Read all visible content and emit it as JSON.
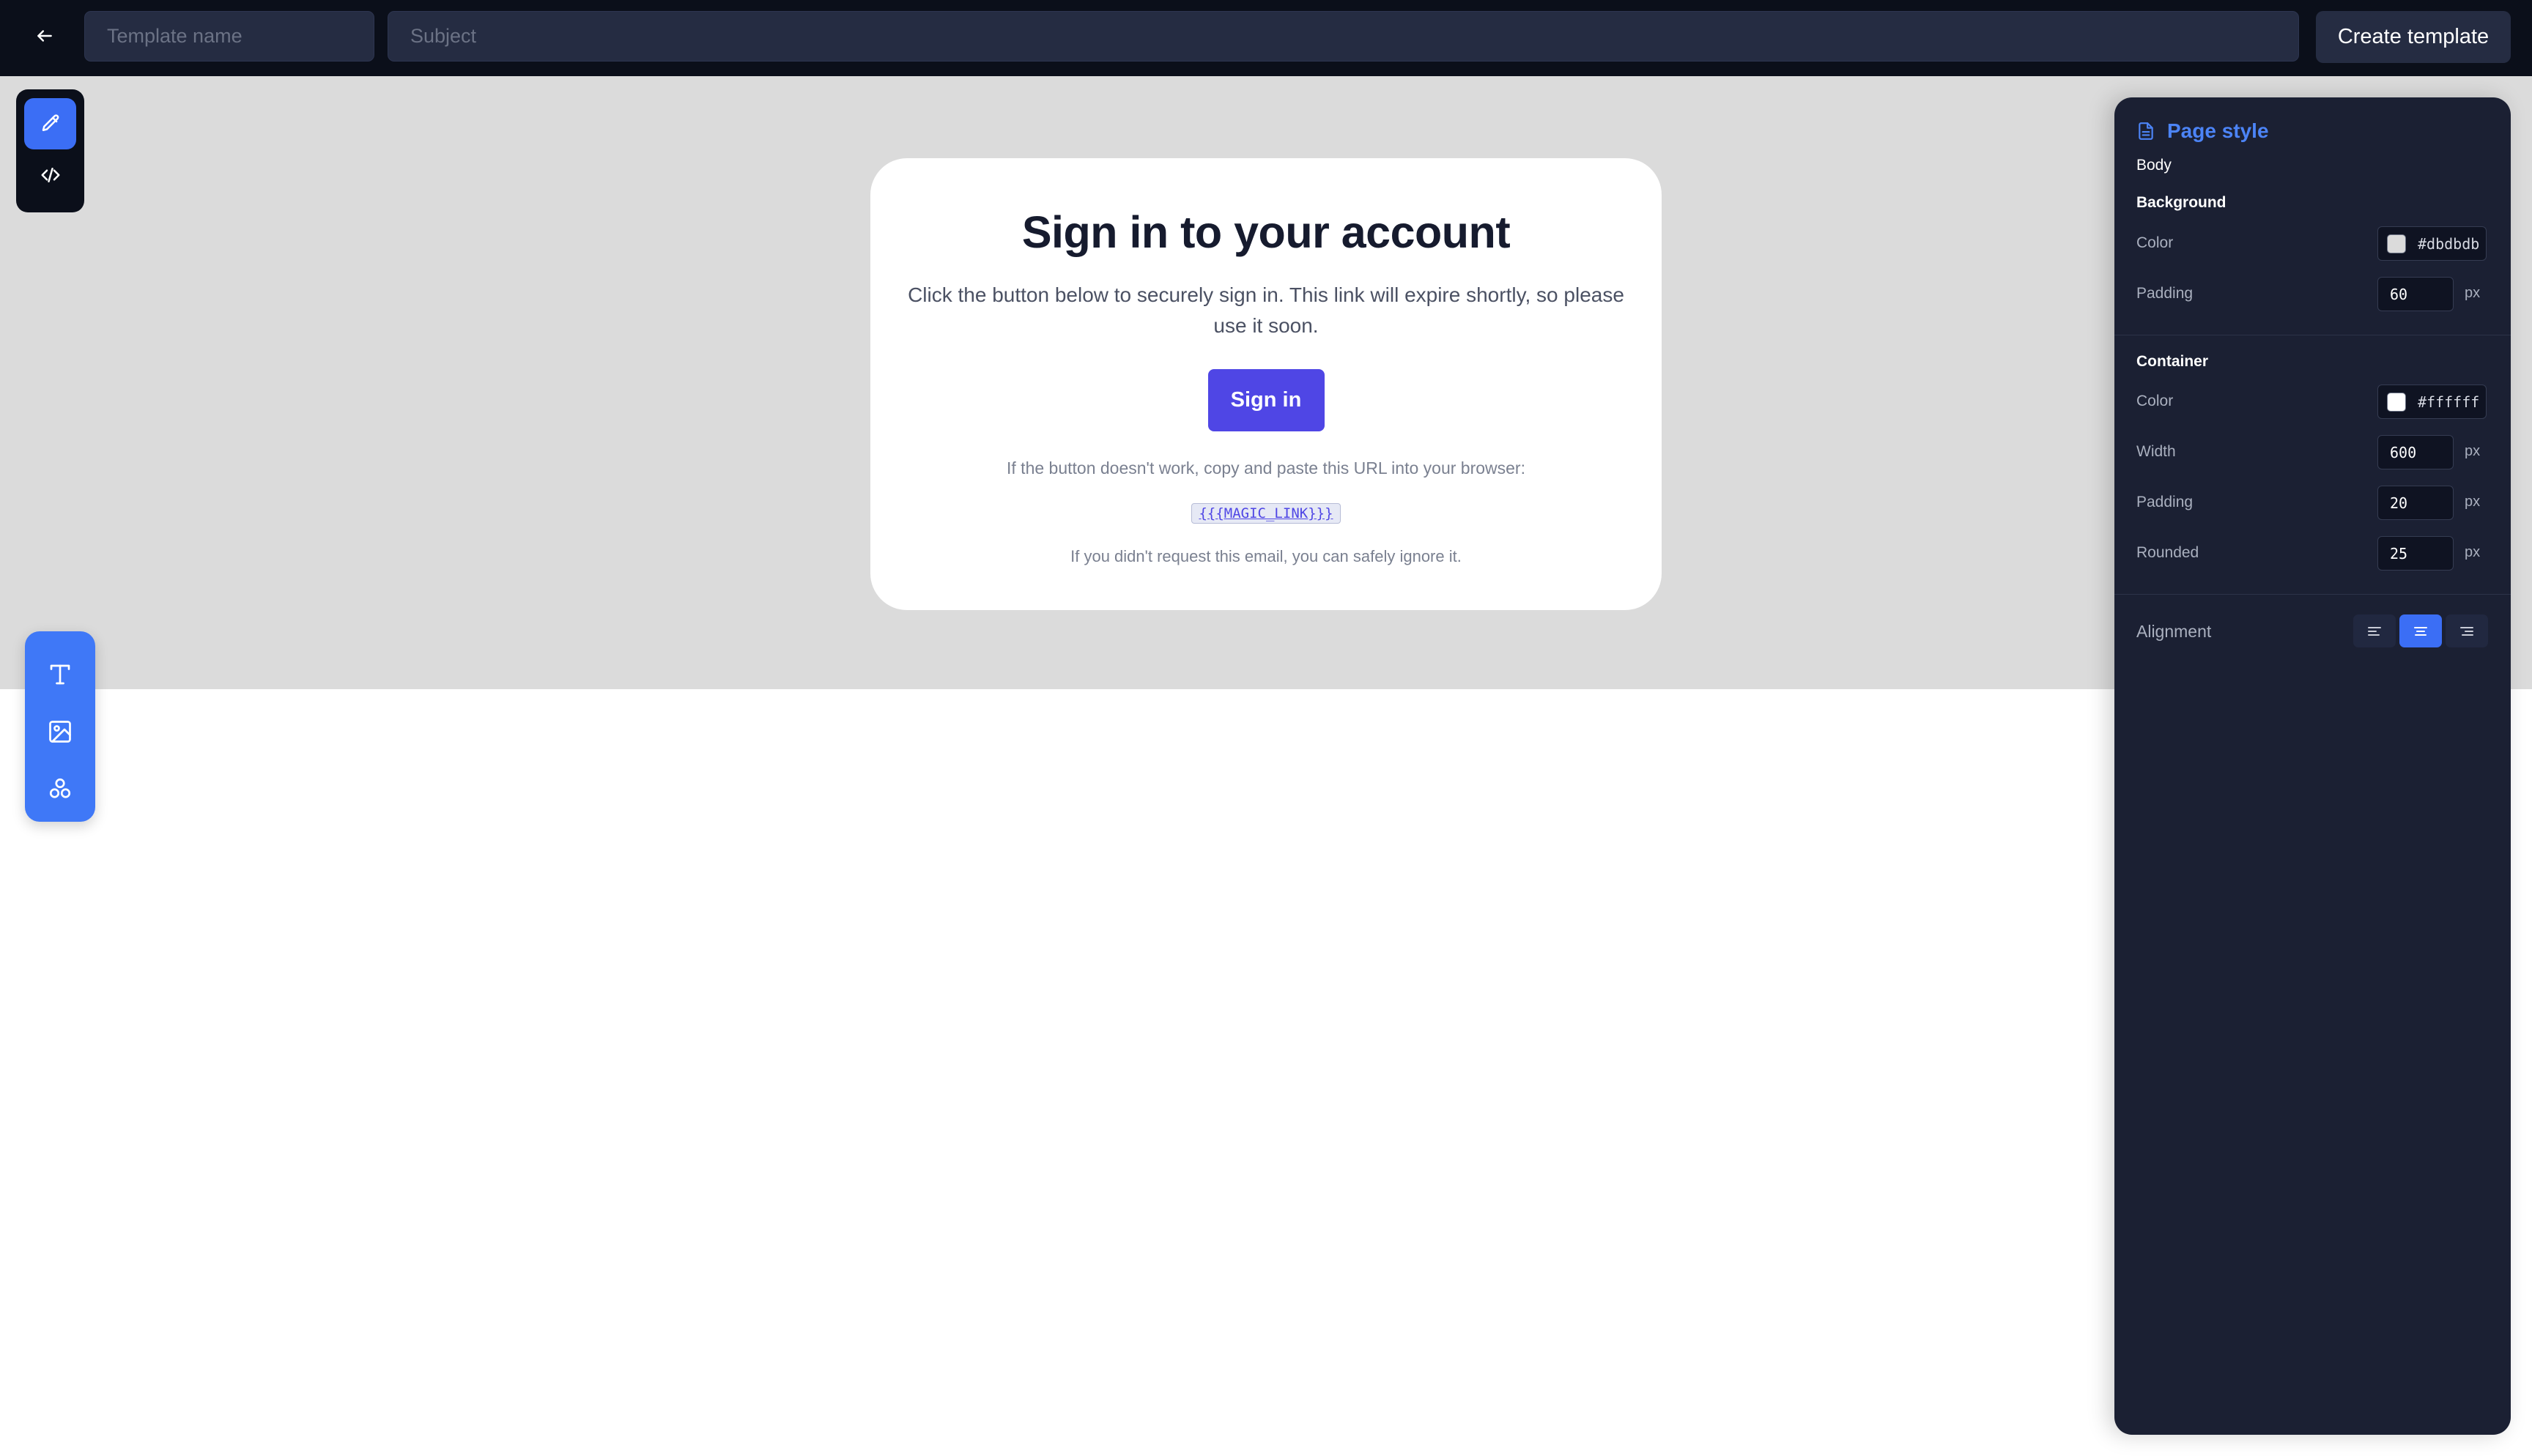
{
  "topbar": {
    "template_name_placeholder": "Template name",
    "subject_placeholder": "Subject",
    "create_label": "Create template",
    "back_icon": "arrow-left-icon"
  },
  "modes": [
    {
      "icon": "pencil-icon",
      "active": true
    },
    {
      "icon": "code-icon",
      "active": false
    }
  ],
  "insert_tools": [
    {
      "icon": "text-icon"
    },
    {
      "icon": "image-icon"
    },
    {
      "icon": "components-icon"
    }
  ],
  "email": {
    "title": "Sign in to your account",
    "body": "Click the button below to securely sign in. This link will expire shortly, so please use it soon.",
    "button_label": "Sign in",
    "fallback_text": "If the button doesn't work, copy and paste this URL into your browser:",
    "magic_link": "{{{MAGIC_LINK}}}",
    "ignore_text": "If you didn't request this email, you can safely ignore it."
  },
  "panel": {
    "title": "Page style",
    "subtitle": "Body",
    "background": {
      "heading": "Background",
      "color_label": "Color",
      "color_value": "#dbdbdb",
      "padding_label": "Padding",
      "padding_value": "60",
      "unit": "px"
    },
    "container": {
      "heading": "Container",
      "color_label": "Color",
      "color_value": "#ffffff",
      "width_label": "Width",
      "width_value": "600",
      "padding_label": "Padding",
      "padding_value": "20",
      "rounded_label": "Rounded",
      "rounded_value": "25",
      "unit": "px"
    },
    "alignment": {
      "label": "Alignment",
      "options": [
        "left",
        "center",
        "right"
      ],
      "selected": "center"
    }
  },
  "colors": {
    "accent": "#3b6ef5",
    "button": "#4f46e5",
    "topbar": "#0b0f1a",
    "panel": "#1b2033"
  }
}
